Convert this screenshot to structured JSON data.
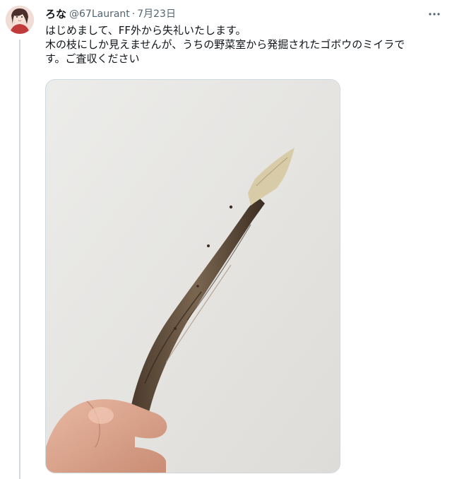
{
  "tweet": {
    "display_name": "ろな",
    "handle": "@67Laurant",
    "separator": "·",
    "date": "7月23日",
    "text_lines": [
      "はじめまして、FF外から失礼いたします。",
      "木の枝にしか見えませんが、うちの野菜室から発掘されたゴボウのミイラで",
      "す。ご査収ください"
    ],
    "avatar_icon": "user-avatar",
    "more_icon": "more-horizontal-icon",
    "media_icon": "photo-dried-burdock-root"
  },
  "colors": {
    "text_primary": "#0f1419",
    "text_secondary": "#536471",
    "thread_line": "#cfd9de",
    "media_background": "#e6e6e4"
  }
}
